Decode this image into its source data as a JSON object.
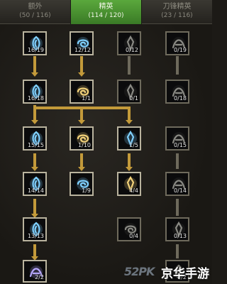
{
  "tabs": [
    {
      "name": "额外",
      "count": "(50 / 116)",
      "active": false
    },
    {
      "name": "精英",
      "count": "(114 / 120)",
      "active": true
    },
    {
      "name": "刀锋精英",
      "count": "(23 / 116)",
      "active": false
    }
  ],
  "skills": [
    {
      "points": "16/19",
      "color": "#7fd0ff",
      "icon": "blue-spirit-icon",
      "on": true
    },
    {
      "points": "12/12",
      "color": "#7fd0ff",
      "icon": "blue-flame-icon",
      "on": true
    },
    {
      "points": "0/12",
      "color": "#8a8a84",
      "icon": "grey-ghost-icon",
      "on": false
    },
    {
      "points": "0/19",
      "color": "#8a8a84",
      "icon": "grey-sword-icon",
      "on": false
    },
    {
      "points": "16/18",
      "color": "#7fd0ff",
      "icon": "blue-swirl-icon",
      "on": true
    },
    {
      "points": "1/1",
      "color": "#f3d27a",
      "icon": "gold-seal-icon",
      "on": true
    },
    {
      "points": "0/1",
      "color": "#8a8a84",
      "icon": "grey-horn-icon",
      "on": false
    },
    {
      "points": "0/18",
      "color": "#8a8a84",
      "icon": "grey-drake-icon",
      "on": false
    },
    {
      "points": "15/15",
      "color": "#7fd0ff",
      "icon": "blue-claw-icon",
      "on": true
    },
    {
      "points": "1/10",
      "color": "#f3d27a",
      "icon": "gold-dancer-icon",
      "on": true
    },
    {
      "points": "1/5",
      "color": "#7fd0ff",
      "icon": "blue-burst-icon",
      "on": true
    },
    {
      "points": "0/15",
      "color": "#8a8a84",
      "icon": "grey-mist-icon",
      "on": false
    },
    {
      "points": "14/14",
      "color": "#7fd0ff",
      "icon": "blue-wing-icon",
      "on": true
    },
    {
      "points": "1/9",
      "color": "#7fd0ff",
      "icon": "blue-wave-icon",
      "on": true
    },
    {
      "points": "4/4",
      "color": "#f3d27a",
      "icon": "gold-orb-icon",
      "on": true
    },
    {
      "points": "0/14",
      "color": "#8a8a84",
      "icon": "grey-coil-icon",
      "on": false
    },
    {
      "points": "13/13",
      "color": "#7fd0ff",
      "icon": "blue-wisp-icon",
      "on": true
    },
    {
      "points": "0/4",
      "color": "#8a8a84",
      "icon": "grey-bloom-icon",
      "on": false
    },
    {
      "points": "0/13",
      "color": "#8a8a84",
      "icon": "grey-ring-icon",
      "on": false
    },
    {
      "points": "2/2",
      "color": "#b7a8ff",
      "icon": "violet-blossom-icon",
      "on": true
    },
    {
      "points": "0/2",
      "color": "#8a8a84",
      "icon": "grey-shard-icon",
      "on": false
    }
  ],
  "watermark": {
    "logo": "52PK",
    "text": "京华手游"
  }
}
